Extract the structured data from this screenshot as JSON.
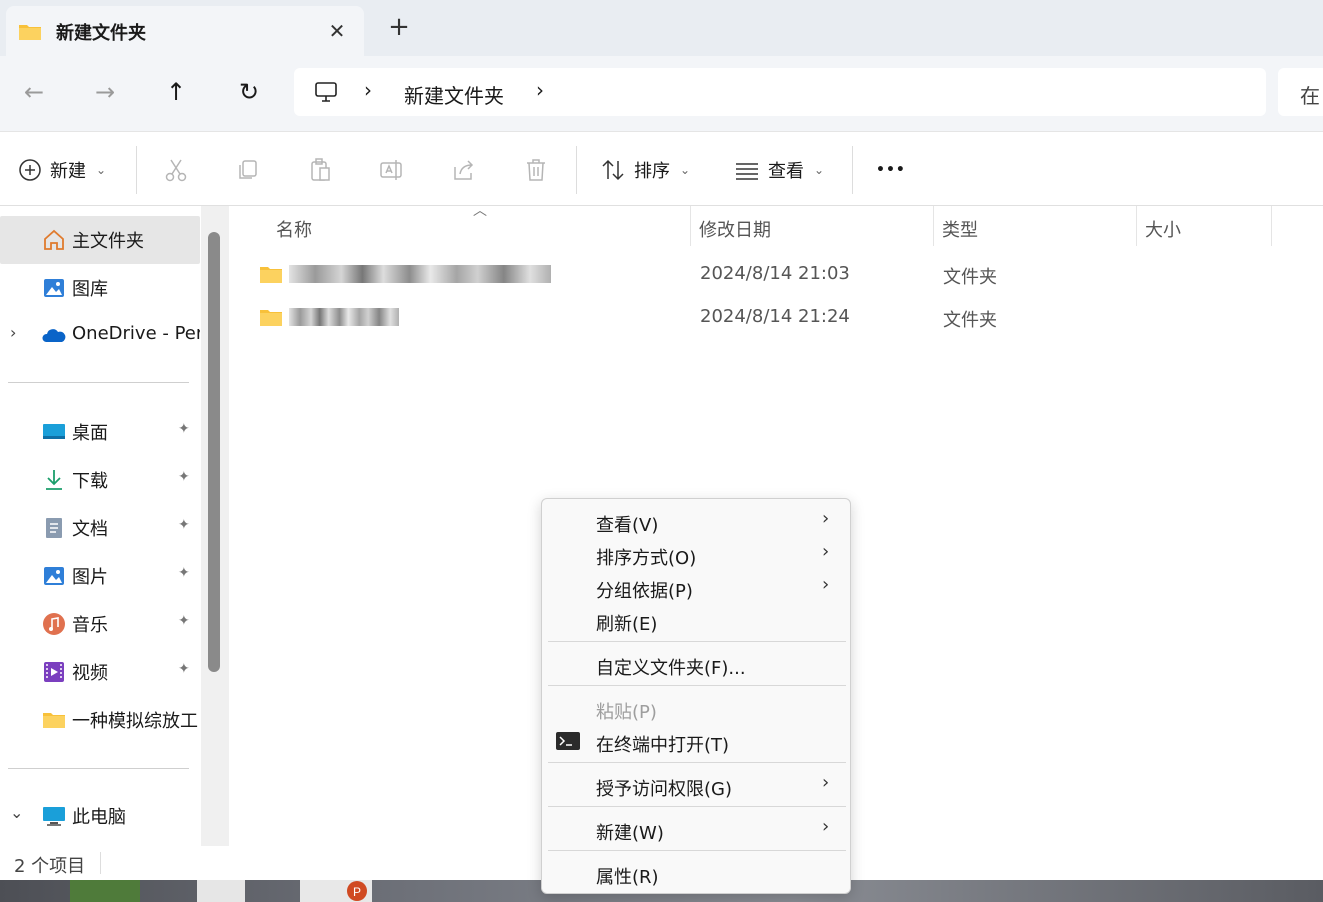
{
  "tab": {
    "title": "新建文件夹",
    "close": "✕",
    "new_tab": "+"
  },
  "nav": {
    "back": "←",
    "forward": "→",
    "up": "↑",
    "refresh": "↻",
    "breadcrumb_sep": "›",
    "breadcrumb_folder": "新建文件夹",
    "search_hint": "在"
  },
  "commands": {
    "new_label": "新建",
    "sort_label": "排序",
    "view_label": "查看",
    "more": "•••"
  },
  "sidebar": {
    "items": [
      {
        "label": "主文件夹",
        "icon": "home-icon"
      },
      {
        "label": "图库",
        "icon": "gallery-icon"
      },
      {
        "label": "OneDrive - Per",
        "icon": "onedrive-icon"
      },
      {
        "label": "桌面",
        "icon": "desktop-icon"
      },
      {
        "label": "下载",
        "icon": "download-icon"
      },
      {
        "label": "文档",
        "icon": "document-icon"
      },
      {
        "label": "图片",
        "icon": "pictures-icon"
      },
      {
        "label": "音乐",
        "icon": "music-icon"
      },
      {
        "label": "视频",
        "icon": "video-icon"
      },
      {
        "label": "一种模拟综放工",
        "icon": "folder-icon"
      },
      {
        "label": "此电脑",
        "icon": "pc-icon"
      }
    ],
    "pin": "📌",
    "expand_collapsed": "›",
    "expand_open": "⌄"
  },
  "columns": {
    "name": "名称",
    "modified": "修改日期",
    "type": "类型",
    "size": "大小"
  },
  "files": [
    {
      "date": "2024/8/14 21:03",
      "type": "文件夹"
    },
    {
      "date": "2024/8/14 21:24",
      "type": "文件夹"
    }
  ],
  "status": {
    "count": "2 个项目"
  },
  "context_menu": {
    "view": "查看(V)",
    "sort_by": "排序方式(O)",
    "group_by": "分组依据(P)",
    "refresh": "刷新(E)",
    "customize": "自定义文件夹(F)...",
    "paste": "粘贴(P)",
    "open_terminal": "在终端中打开(T)",
    "give_access": "授予访问权限(G)",
    "new": "新建(W)",
    "properties": "属性(R)",
    "submenu_arrow": "›"
  },
  "colors": {
    "folder": "#f8c13a",
    "accent": "#0067c0"
  }
}
